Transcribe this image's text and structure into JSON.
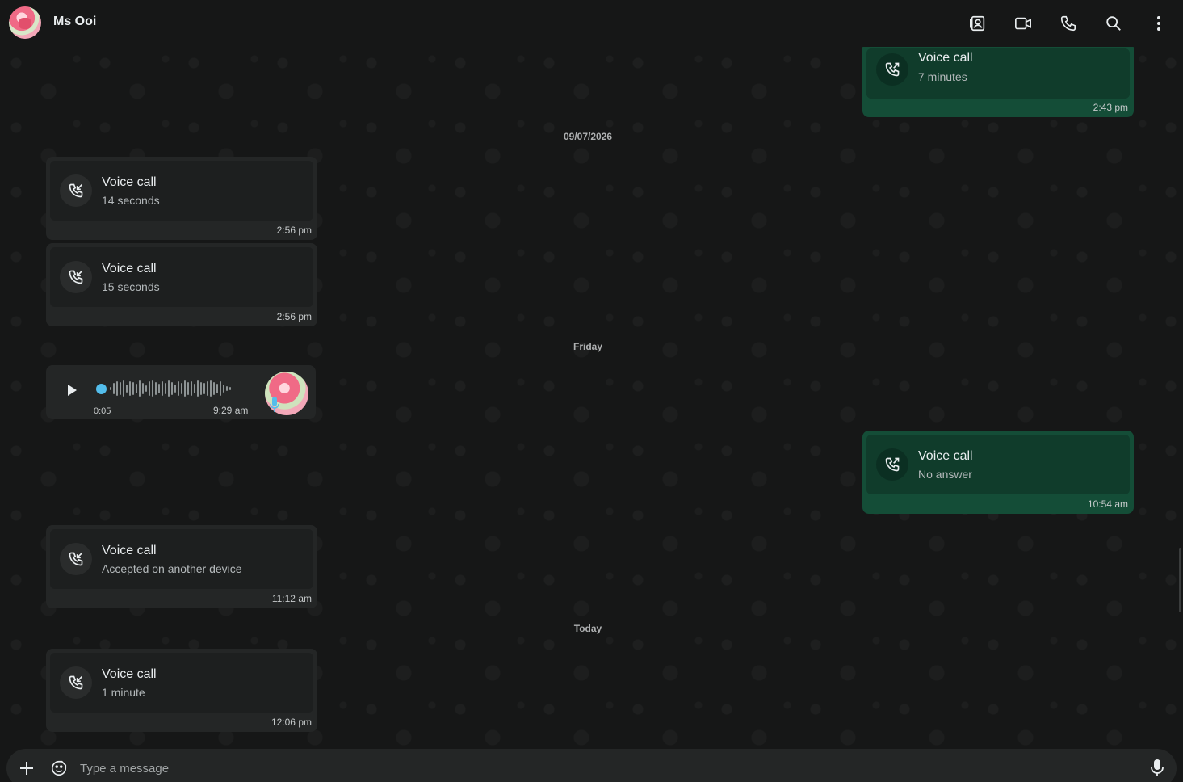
{
  "header": {
    "contact_name": "Ms Ooi",
    "icons": [
      "contacts-icon",
      "video-call-icon",
      "voice-call-icon",
      "search-icon",
      "menu-icon"
    ]
  },
  "colors": {
    "incoming_bubble": "#242626",
    "outgoing_bubble": "#144d37",
    "accent_blue": "#53bdeb",
    "background": "#161717"
  },
  "separators": {
    "date1": "09/07/2026",
    "date2": "Friday",
    "date3": "Today"
  },
  "messages": {
    "m0": {
      "title": "Voice call",
      "subtitle": "7 minutes",
      "time": "2:43 pm",
      "direction": "outgoing"
    },
    "m1": {
      "title": "Voice call",
      "subtitle": "14 seconds",
      "time": "2:56 pm",
      "direction": "incoming"
    },
    "m2": {
      "title": "Voice call",
      "subtitle": "15 seconds",
      "time": "2:56 pm",
      "direction": "incoming"
    },
    "voice_note": {
      "duration": "0:05",
      "time": "9:29 am",
      "progress": 0.0
    },
    "m3": {
      "title": "Voice call",
      "subtitle": "No answer",
      "time": "10:54 am",
      "direction": "outgoing"
    },
    "m4": {
      "title": "Voice call",
      "subtitle": "Accepted on another device",
      "time": "11:12 am",
      "direction": "incoming"
    },
    "m5": {
      "title": "Voice call",
      "subtitle": "1 minute",
      "time": "12:06 pm",
      "direction": "incoming"
    }
  },
  "composer": {
    "placeholder": "Type a message"
  }
}
